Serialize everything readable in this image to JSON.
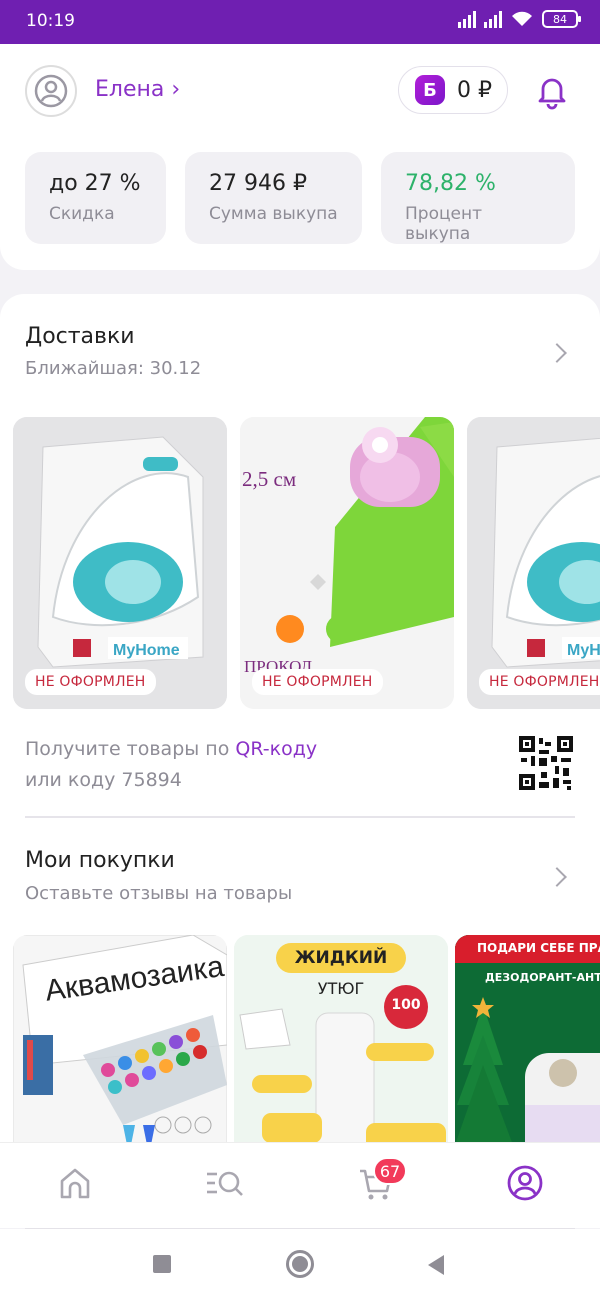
{
  "status": {
    "time": "10:19",
    "battery": "84"
  },
  "profile": {
    "name": "Елена ›",
    "bonus_letter": "Б",
    "bonus_balance": "0 ₽"
  },
  "stats": [
    {
      "value": "до 27 %",
      "label": "Скидка"
    },
    {
      "value": "27 946 ₽",
      "label": "Сумма выкупа"
    },
    {
      "value": "78,82 %",
      "label": "Процент выкупа",
      "color": "#2db26a"
    }
  ],
  "deliveries": {
    "title": "Доставки",
    "subtitle": "Ближайшая: 30.12",
    "items": [
      {
        "badge": "НЕ ОФОРМЛЕН",
        "image_text": ""
      },
      {
        "badge": "НЕ ОФОРМЛЕН",
        "image_text": "2,5 см"
      },
      {
        "badge": "НЕ ОФОРМЛЕН",
        "image_text": ""
      }
    ],
    "qr_prefix": "Получите товары по ",
    "qr_link": "QR-коду",
    "qr_suffix": "или коду 75894"
  },
  "purchases": {
    "title": "Мои покупки",
    "subtitle": "Оставьте отзывы на товары",
    "items": [
      {
        "image_text": "Аквамозаика"
      },
      {
        "image_text": "ЖИДКИЙ",
        "image_text2": "УТЮГ",
        "image_text3": "100"
      },
      {
        "image_text": "ПОДАРИ СЕБЕ ПРАЗ",
        "image_text2": "ДЕЗОДОРАНТ-АНТИПЕРС"
      }
    ]
  },
  "nav": {
    "cart_count": "67"
  },
  "colors": {
    "brand": "#6f1fb1",
    "accent": "#8a32c7",
    "badge": "#f23a5a",
    "green": "#2db26a"
  }
}
